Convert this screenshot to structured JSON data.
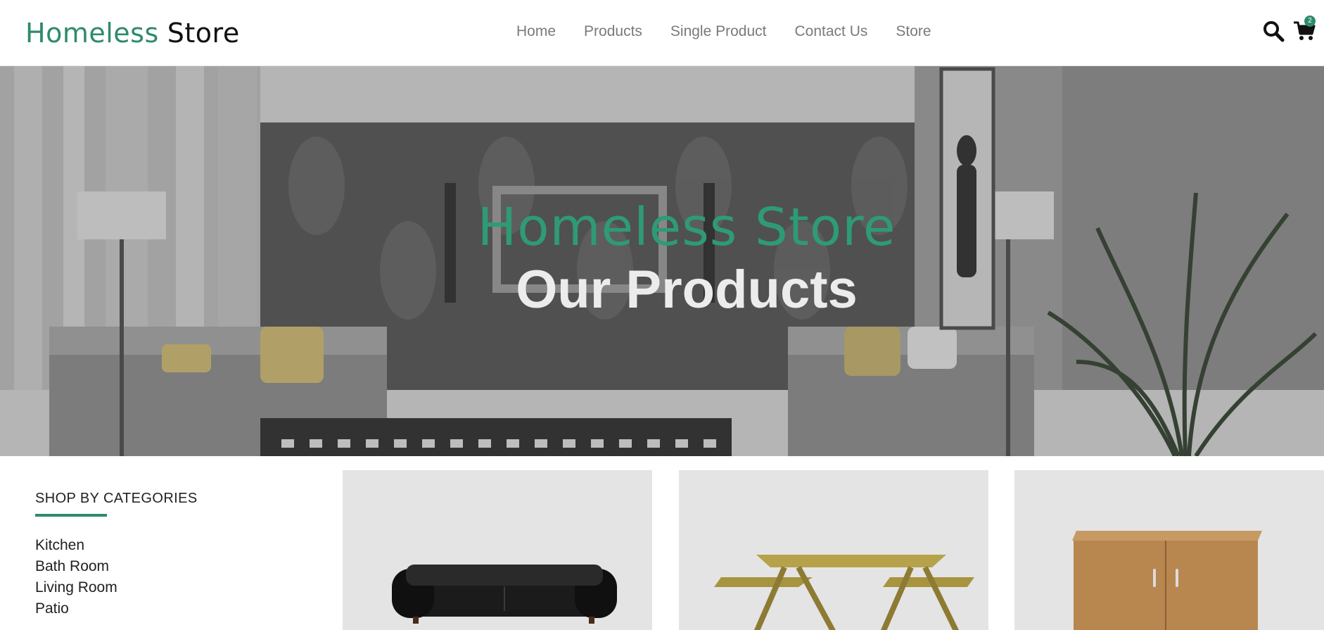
{
  "header": {
    "logo": {
      "part1": "Homeless",
      "part2": "Store"
    },
    "nav": [
      {
        "label": "Home"
      },
      {
        "label": "Products"
      },
      {
        "label": "Single Product"
      },
      {
        "label": "Contact Us"
      },
      {
        "label": "Store"
      }
    ],
    "icons": {
      "search": "search-icon",
      "cart": "cart-icon"
    },
    "cart_count": "2"
  },
  "hero": {
    "title": "Homeless Store",
    "subtitle": "Our Products"
  },
  "sidebar": {
    "heading": "SHOP BY CATEGORIES",
    "categories": [
      {
        "label": "Kitchen"
      },
      {
        "label": "Bath Room"
      },
      {
        "label": "Living Room"
      },
      {
        "label": "Patio"
      }
    ]
  },
  "products": [
    {
      "image": "black-leather-sofa"
    },
    {
      "image": "wooden-picnic-table"
    },
    {
      "image": "wooden-cabinet"
    }
  ],
  "colors": {
    "accent": "#2e8b6a",
    "hero_title": "#2e9b74",
    "nav_text": "#7a7a7a",
    "card_bg": "#e4e4e4"
  }
}
